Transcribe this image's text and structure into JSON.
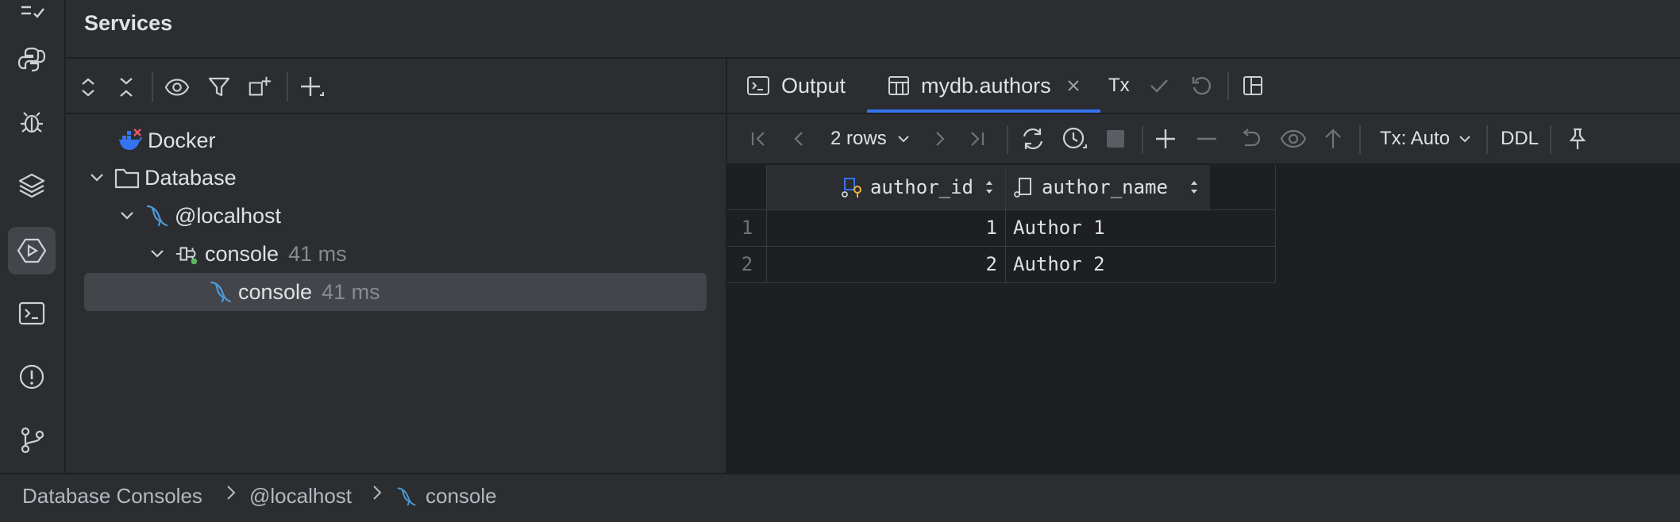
{
  "panel": {
    "title": "Services"
  },
  "tree": {
    "docker": {
      "label": "Docker"
    },
    "database": {
      "label": "Database"
    },
    "localhost": {
      "label": "@localhost"
    },
    "console_parent": {
      "label": "console",
      "time": "41 ms"
    },
    "console_child": {
      "label": "console",
      "time": "41 ms"
    }
  },
  "tabs": {
    "output": "Output",
    "table": "mydb.authors",
    "tx": "Tx"
  },
  "result_toolbar": {
    "rows": "2 rows",
    "tx_mode": "Tx: Auto",
    "ddl": "DDL"
  },
  "grid": {
    "columns": [
      "author_id",
      "author_name"
    ],
    "rows": [
      {
        "num": "1",
        "author_id": "1",
        "author_name": "Author 1"
      },
      {
        "num": "2",
        "author_id": "2",
        "author_name": "Author 2"
      }
    ]
  },
  "breadcrumb": [
    "Database Consoles",
    "@localhost",
    "console"
  ],
  "colors": {
    "accent": "#3574f0",
    "mysql": "#4e9ad8",
    "docker": "#3574f0",
    "status_ok": "#5fb865",
    "error": "#e55765"
  }
}
